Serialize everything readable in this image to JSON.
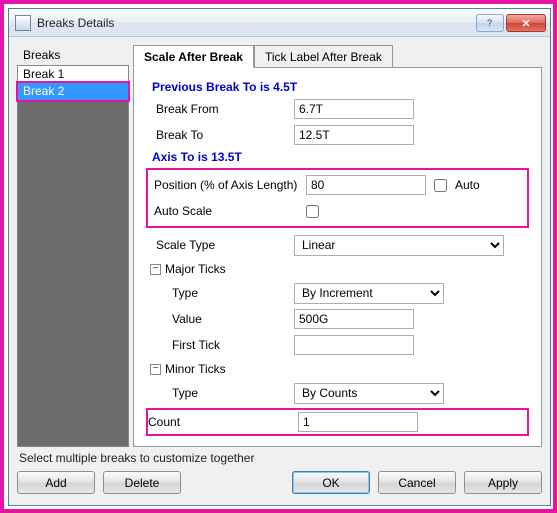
{
  "window": {
    "title": "Breaks Details"
  },
  "left": {
    "header": "Breaks",
    "items": [
      {
        "label": "Break 1",
        "selected": false
      },
      {
        "label": "Break 2",
        "selected": true
      }
    ]
  },
  "tabs": {
    "scale": "Scale After Break",
    "ticklabel": "Tick Label After Break"
  },
  "content": {
    "previous": "Previous Break To is 4.5T",
    "break_from_label": "Break From",
    "break_from_value": "6.7T",
    "break_to_label": "Break To",
    "break_to_value": "12.5T",
    "axis_to": "Axis To is 13.5T",
    "position_label": "Position (% of Axis Length)",
    "position_value": "80",
    "auto_label": "Auto",
    "auto_scale_label": "Auto Scale",
    "scale_type_label": "Scale Type",
    "scale_type_value": "Linear",
    "major_header": "Major Ticks",
    "major_type_label": "Type",
    "major_type_value": "By Increment",
    "major_value_label": "Value",
    "major_value_value": "500G",
    "major_firsttick_label": "First Tick",
    "major_firsttick_value": "",
    "minor_header": "Minor Ticks",
    "minor_type_label": "Type",
    "minor_type_value": "By Counts",
    "minor_count_label": "Count",
    "minor_count_value": "1"
  },
  "footer": {
    "hint": "Select multiple breaks to customize together",
    "add": "Add",
    "delete": "Delete",
    "ok": "OK",
    "cancel": "Cancel",
    "apply": "Apply"
  }
}
